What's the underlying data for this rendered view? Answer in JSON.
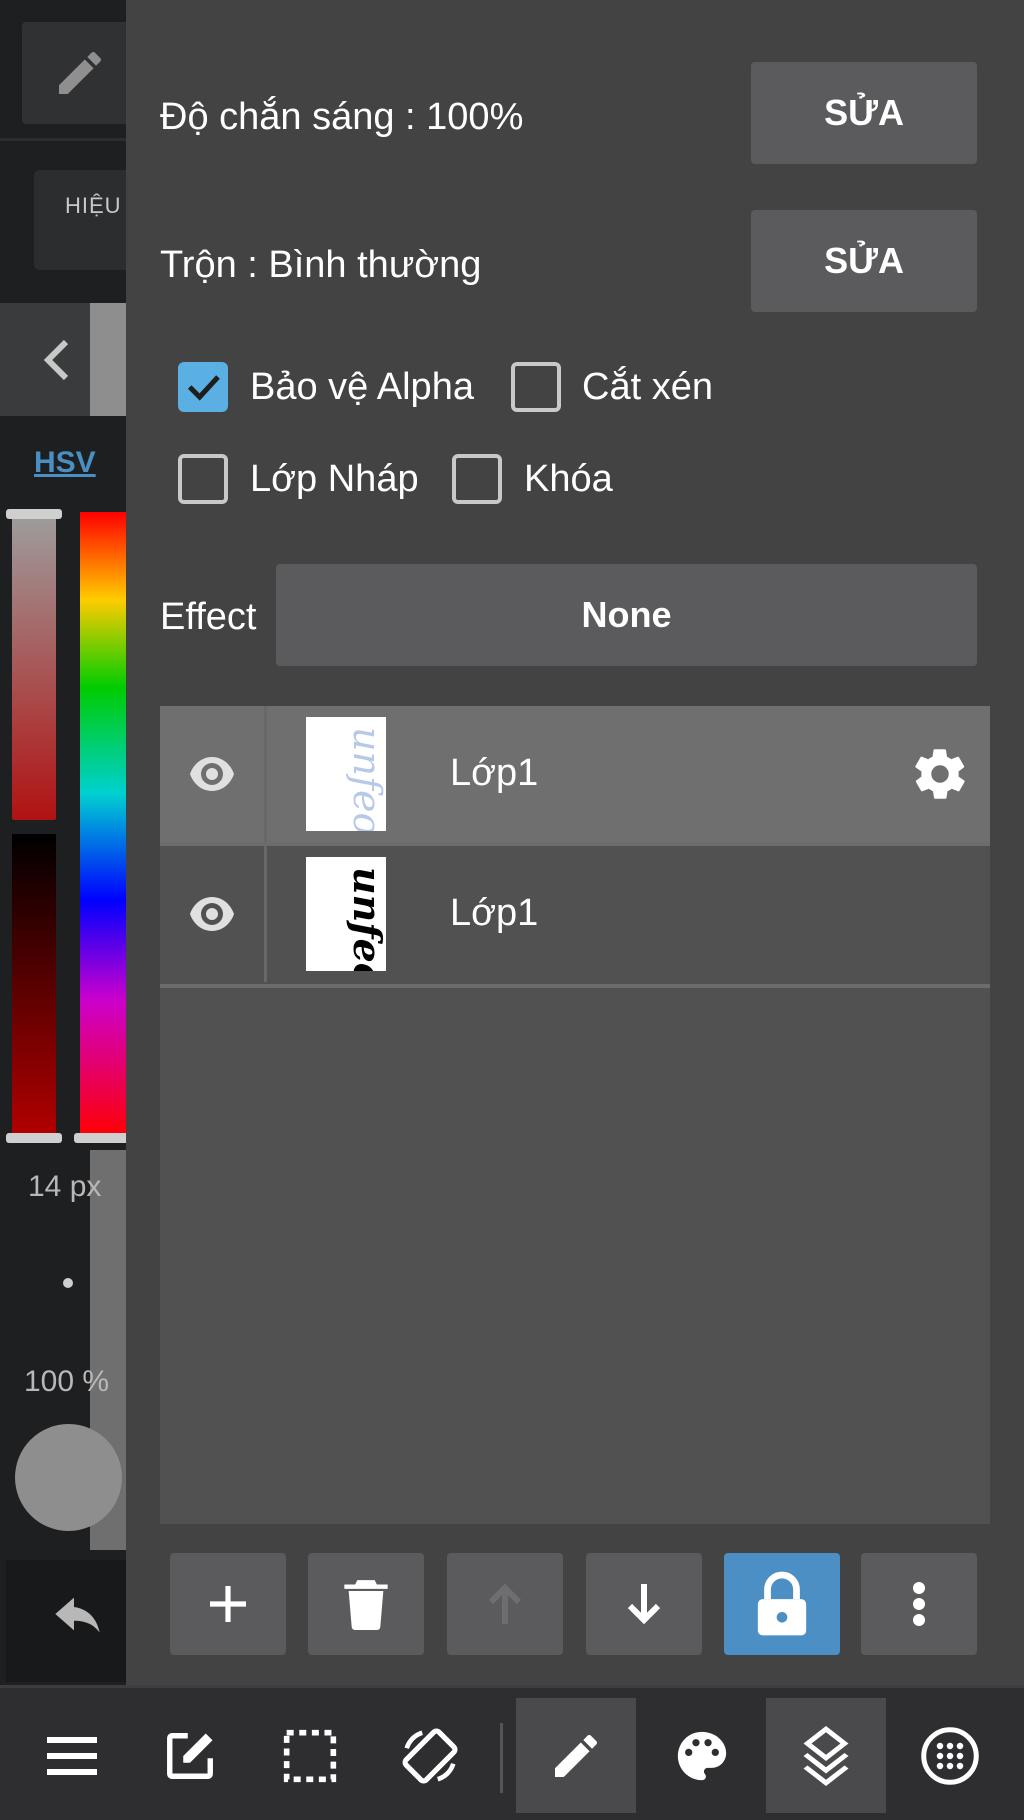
{
  "left_toolbar": {
    "effect_label": "HIỆU",
    "color_mode": "HSV",
    "brush_size": "14 px",
    "brush_opacity": "100 %"
  },
  "layer_panel": {
    "opacity": {
      "label": "Độ chắn sáng : 100%",
      "button": "SỬA"
    },
    "blend": {
      "label": "Trộn : Bình thường",
      "button": "SỬA"
    },
    "checkboxes": [
      {
        "label": "Bảo vệ Alpha",
        "checked": true
      },
      {
        "label": "Cắt xén",
        "checked": false
      },
      {
        "label": "Lớp Nháp",
        "checked": false
      },
      {
        "label": "Khóa",
        "checked": false
      }
    ],
    "effect": {
      "label": "Effect",
      "value": "None"
    },
    "layers": [
      {
        "name": "Lớp1",
        "visible": true,
        "selected": true,
        "thumb_text": "unfeon"
      },
      {
        "name": "Lớp1",
        "visible": true,
        "selected": false,
        "thumb_text": "unfeon"
      }
    ],
    "toolbar": [
      "add-layer",
      "delete-layer",
      "move-up",
      "move-down",
      "lock",
      "more"
    ]
  },
  "bottom_bar": {
    "items": [
      "menu",
      "edit",
      "selection",
      "rotate",
      "brush",
      "palette",
      "layers",
      "materials"
    ],
    "active": [
      "brush",
      "layers"
    ]
  },
  "colors": {
    "accent": "#4c8fc4",
    "checkbox_on": "#5ab0e2",
    "panel_bg": "#434343"
  }
}
